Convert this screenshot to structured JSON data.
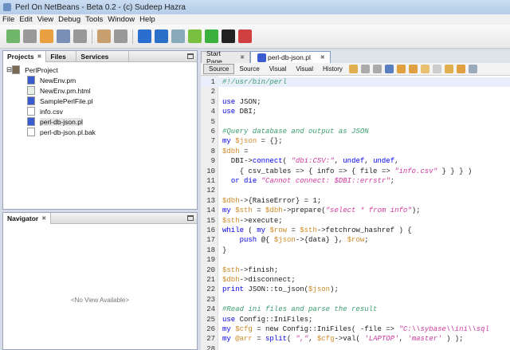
{
  "window": {
    "title": "Perl On NetBeans - Beta 0.2 - (c) Sudeep Hazra"
  },
  "menu": [
    "File",
    "Edit",
    "View",
    "Debug",
    "Tools",
    "Window",
    "Help"
  ],
  "toolbar_icons": [
    "new-file-icon",
    "new-project-icon",
    "open-project-icon",
    "open-file-icon",
    "save-all-icon",
    "undo-icon",
    "redo-icon",
    "module-icon",
    "run-perl-icon",
    "deploy-icon",
    "build-icon",
    "run-icon",
    "terminal-icon",
    "library-icon"
  ],
  "projects_panel": {
    "tabs": [
      "Projects",
      "Files",
      "Services"
    ],
    "root": "PerlProject",
    "files": [
      {
        "name": "NewEnv.pm",
        "type": "pl"
      },
      {
        "name": "NewEnv.pm.html",
        "type": "html"
      },
      {
        "name": "SamplePerlFile.pl",
        "type": "pl"
      },
      {
        "name": "info.csv",
        "type": "txt"
      },
      {
        "name": "perl-db-json.pl",
        "type": "pl"
      },
      {
        "name": "perl-db-json.pl.bak",
        "type": "txt"
      }
    ],
    "selected": "perl-db-json.pl"
  },
  "navigator": {
    "title": "Navigator",
    "empty": "<No View Available>"
  },
  "editor": {
    "tabs": [
      "Start Page",
      "perl-db-json.pl"
    ],
    "active_tab": "perl-db-json.pl",
    "view_buttons": [
      "Source",
      "Source",
      "Visual",
      "Visual",
      "History"
    ],
    "lines": [
      [
        [
          "#!/usr/bin/perl",
          "cm"
        ]
      ],
      [],
      [
        [
          "use",
          "kw"
        ],
        [
          " JSON;",
          "pl"
        ]
      ],
      [
        [
          "use",
          "kw"
        ],
        [
          " DBI;",
          "pl"
        ]
      ],
      [],
      [
        [
          "#Query database and output as JSON",
          "cm"
        ]
      ],
      [
        [
          "my",
          "kw"
        ],
        [
          " ",
          "pl"
        ],
        [
          "$json",
          "var"
        ],
        [
          " = {};",
          "pl"
        ]
      ],
      [
        [
          "$dbh",
          "var"
        ],
        [
          " =",
          "pl"
        ]
      ],
      [
        [
          "  DBI->",
          "pl"
        ],
        [
          "connect",
          "kw"
        ],
        [
          "( ",
          "pl"
        ],
        [
          "\"dbi:CSV:\"",
          "str"
        ],
        [
          ", ",
          "pl"
        ],
        [
          "undef",
          "kw"
        ],
        [
          ", ",
          "pl"
        ],
        [
          "undef",
          "kw"
        ],
        [
          ",",
          "pl"
        ]
      ],
      [
        [
          "    { csv_tables => { info => { file => ",
          "pl"
        ],
        [
          "\"info.csv\"",
          "str"
        ],
        [
          " } } } )",
          "pl"
        ]
      ],
      [
        [
          "  ",
          "pl"
        ],
        [
          "or",
          "kw"
        ],
        [
          " ",
          "pl"
        ],
        [
          "die",
          "kw"
        ],
        [
          " ",
          "pl"
        ],
        [
          "\"Cannot connect: $DBI::errstr\"",
          "str"
        ],
        [
          ";",
          "pl"
        ]
      ],
      [],
      [
        [
          "$dbh",
          "var"
        ],
        [
          "->{RaiseError} = 1;",
          "pl"
        ]
      ],
      [
        [
          "my",
          "kw"
        ],
        [
          " ",
          "pl"
        ],
        [
          "$sth",
          "var"
        ],
        [
          " = ",
          "pl"
        ],
        [
          "$dbh",
          "var"
        ],
        [
          "->prepare(",
          "pl"
        ],
        [
          "\"select * from info\"",
          "str"
        ],
        [
          ");",
          "pl"
        ]
      ],
      [
        [
          "$sth",
          "var"
        ],
        [
          "->execute;",
          "pl"
        ]
      ],
      [
        [
          "while",
          "kw"
        ],
        [
          " ( ",
          "pl"
        ],
        [
          "my",
          "kw"
        ],
        [
          " ",
          "pl"
        ],
        [
          "$row",
          "var"
        ],
        [
          " = ",
          "pl"
        ],
        [
          "$sth",
          "var"
        ],
        [
          "->fetchrow_hashref ) {",
          "pl"
        ]
      ],
      [
        [
          "    ",
          "pl"
        ],
        [
          "push",
          "kw"
        ],
        [
          " @{ ",
          "pl"
        ],
        [
          "$json",
          "var"
        ],
        [
          "->{data} }, ",
          "pl"
        ],
        [
          "$row",
          "var"
        ],
        [
          ";",
          "pl"
        ]
      ],
      [
        [
          "}",
          "pl"
        ]
      ],
      [],
      [
        [
          "$sth",
          "var"
        ],
        [
          "->finish;",
          "pl"
        ]
      ],
      [
        [
          "$dbh",
          "var"
        ],
        [
          "->disconnect;",
          "pl"
        ]
      ],
      [
        [
          "print",
          "kw"
        ],
        [
          " JSON::to_json(",
          "pl"
        ],
        [
          "$json",
          "var"
        ],
        [
          ");",
          "pl"
        ]
      ],
      [],
      [
        [
          "#Read ini files and parse the result",
          "cm"
        ]
      ],
      [
        [
          "use",
          "kw"
        ],
        [
          " Config::IniFiles;",
          "pl"
        ]
      ],
      [
        [
          "my",
          "kw"
        ],
        [
          " ",
          "pl"
        ],
        [
          "$cfg",
          "var"
        ],
        [
          " = new Config::IniFiles( -file => ",
          "pl"
        ],
        [
          "\"C:\\\\sybase\\\\ini\\\\sql",
          "str"
        ]
      ],
      [
        [
          "my",
          "kw"
        ],
        [
          " ",
          "pl"
        ],
        [
          "@arr",
          "var"
        ],
        [
          " = ",
          "pl"
        ],
        [
          "split",
          "kw"
        ],
        [
          "( ",
          "pl"
        ],
        [
          "\",\"",
          "str"
        ],
        [
          ", ",
          "pl"
        ],
        [
          "$cfg",
          "var"
        ],
        [
          "->val( ",
          "pl"
        ],
        [
          "'LAPTOP'",
          "str"
        ],
        [
          ", ",
          "pl"
        ],
        [
          "'master'",
          "str"
        ],
        [
          " ) );",
          "pl"
        ]
      ],
      []
    ]
  }
}
